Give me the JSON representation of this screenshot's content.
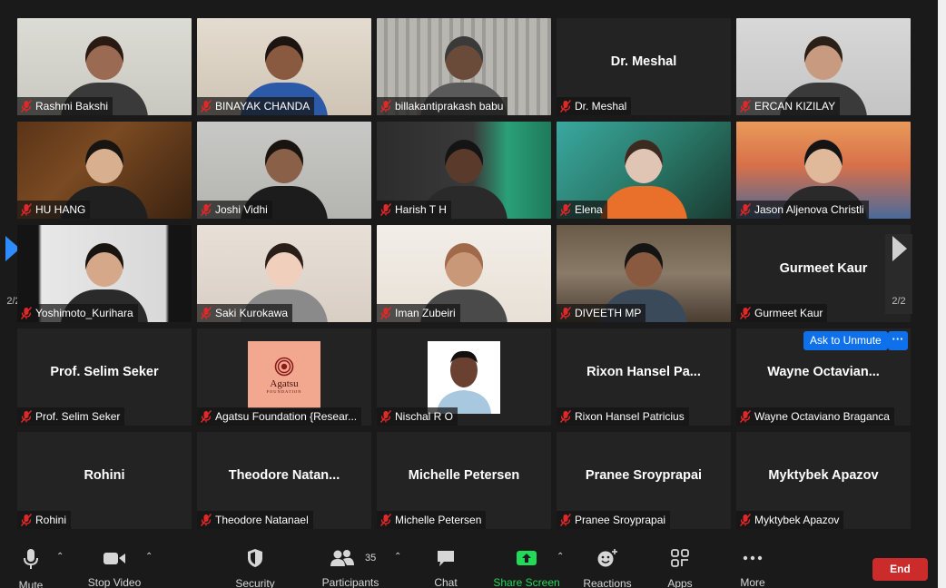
{
  "colors": {
    "background": "#1a1a1a",
    "tile": "#232323",
    "accent_blue": "#0e71eb",
    "end_red": "#cc2b2b",
    "share_green": "#23d959",
    "mute_red": "#e02828"
  },
  "pager": {
    "left_label": "2/2",
    "right_label": "2/2"
  },
  "participants": [
    {
      "name": "Rashmi Bakshi",
      "kind": "video"
    },
    {
      "name": "BINAYAK CHANDA",
      "kind": "video"
    },
    {
      "name": "billakantiprakash babu",
      "kind": "video"
    },
    {
      "name": "Dr. Meshal",
      "kind": "name",
      "display": "Dr. Meshal"
    },
    {
      "name": "ERCAN KIZILAY",
      "kind": "video"
    },
    {
      "name": "HU HANG",
      "kind": "video"
    },
    {
      "name": "Joshi Vidhi",
      "kind": "video"
    },
    {
      "name": "Harish T H",
      "kind": "video"
    },
    {
      "name": "Elena",
      "kind": "video"
    },
    {
      "name": "Jason Aljenova Christli",
      "kind": "video"
    },
    {
      "name": "Yoshimoto_Kurihara",
      "kind": "video"
    },
    {
      "name": "Saki Kurokawa",
      "kind": "video"
    },
    {
      "name": "Iman Zubeiri",
      "kind": "video"
    },
    {
      "name": "DIVEETH MP",
      "kind": "video"
    },
    {
      "name": "Gurmeet Kaur",
      "kind": "name",
      "display": "Gurmeet Kaur"
    },
    {
      "name": "Prof. Selim Seker",
      "kind": "name",
      "display": "Prof. Selim Seker"
    },
    {
      "name": "Agatsu Foundation {Resear...",
      "kind": "logo",
      "logo_text": "Agatsu",
      "logo_sub": "FOUNDATION"
    },
    {
      "name": "Nischal R O",
      "kind": "photo"
    },
    {
      "name": "Rixon Hansel Patricius",
      "kind": "name",
      "display": "Rixon  Hansel  Pa..."
    },
    {
      "name": "Wayne Octaviano Braganca",
      "kind": "name",
      "display": "Wayne  Octavian...",
      "ask_unmute": "Ask to Unmute",
      "more": "···"
    },
    {
      "name": "Rohini",
      "kind": "name",
      "display": "Rohini"
    },
    {
      "name": "Theodore Natanael",
      "kind": "name",
      "display": "Theodore  Natan..."
    },
    {
      "name": "Michelle Petersen",
      "kind": "name",
      "display": "Michelle Petersen"
    },
    {
      "name": "Pranee Sroyprapai",
      "kind": "name",
      "display": "Pranee Sroyprapai"
    },
    {
      "name": "Myktybek Apazov",
      "kind": "name",
      "display": "Myktybek Apazov"
    }
  ],
  "toolbar": {
    "mute": "Mute",
    "stop_video": "Stop Video",
    "security": "Security",
    "participants": "Participants",
    "participants_count": "35",
    "chat": "Chat",
    "share_screen": "Share Screen",
    "reactions": "Reactions",
    "apps": "Apps",
    "more": "More",
    "end": "End"
  }
}
